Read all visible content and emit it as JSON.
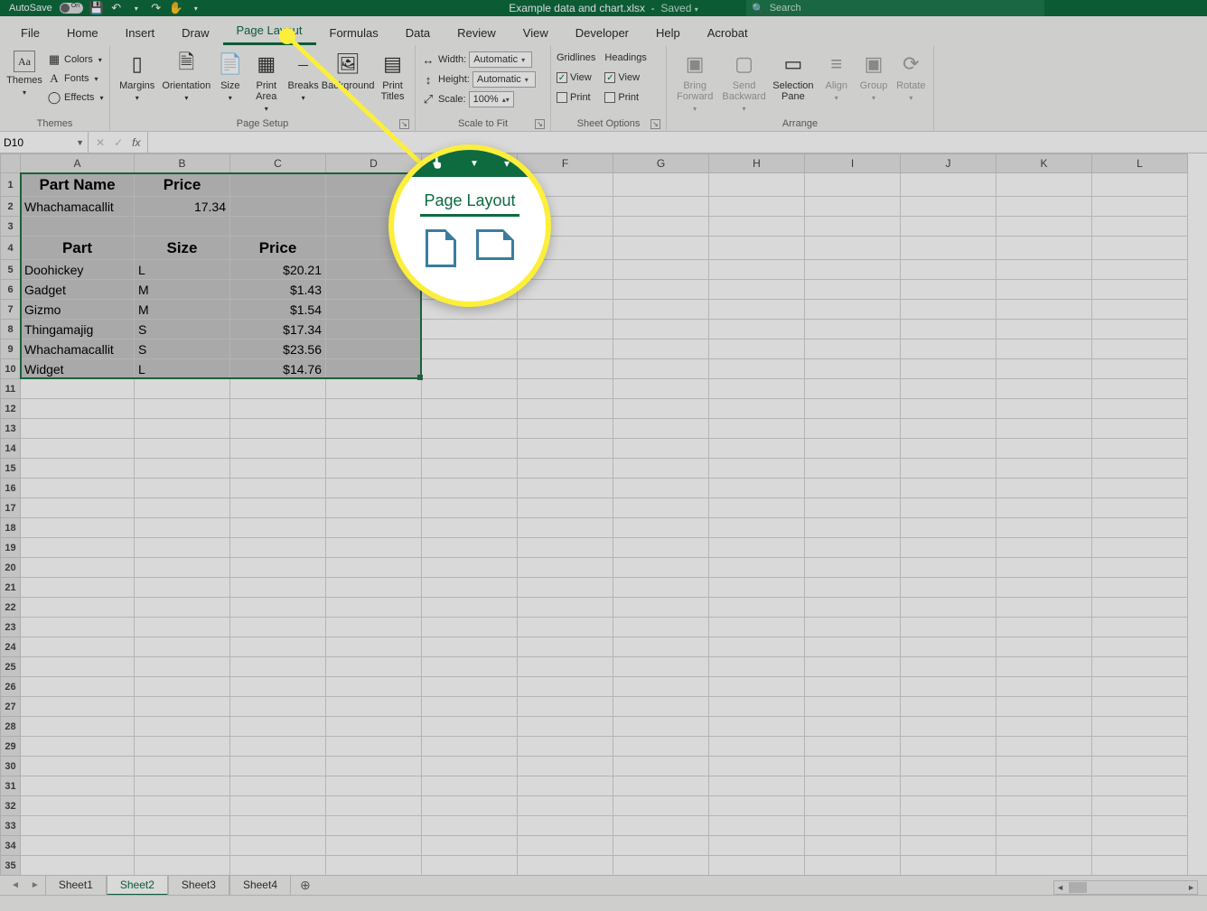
{
  "title": {
    "autosave_label": "AutoSave",
    "autosave_on": "On",
    "filename": "Example data and chart.xlsx",
    "save_status": "Saved",
    "search_placeholder": "Search"
  },
  "tabs": {
    "file": "File",
    "home": "Home",
    "insert": "Insert",
    "draw": "Draw",
    "page_layout": "Page Layout",
    "formulas": "Formulas",
    "data": "Data",
    "review": "Review",
    "view": "View",
    "developer": "Developer",
    "help": "Help",
    "acrobat": "Acrobat",
    "active": "page_layout"
  },
  "ribbon": {
    "themes": {
      "label": "Themes",
      "themes": "Themes",
      "colors": "Colors",
      "fonts": "Fonts",
      "effects": "Effects"
    },
    "page_setup": {
      "label": "Page Setup",
      "margins": "Margins",
      "orientation": "Orientation",
      "size": "Size",
      "print_area": "Print\nArea",
      "breaks": "Breaks",
      "background": "Background",
      "print_titles": "Print\nTitles"
    },
    "scale": {
      "label": "Scale to Fit",
      "width": "Width:",
      "height": "Height:",
      "scale": "Scale:",
      "auto": "Automatic",
      "pct": "100%"
    },
    "sheet_options": {
      "label": "Sheet Options",
      "gridlines": "Gridlines",
      "headings": "Headings",
      "view": "View",
      "print": "Print"
    },
    "arrange": {
      "label": "Arrange",
      "bring_forward": "Bring\nForward",
      "send_backward": "Send\nBackward",
      "selection_pane": "Selection\nPane",
      "align": "Align",
      "group": "Group",
      "rotate": "Rotate"
    }
  },
  "formula_bar": {
    "name_box": "D10"
  },
  "columns": [
    "A",
    "B",
    "C",
    "D",
    "E",
    "F",
    "G",
    "H",
    "I",
    "J",
    "K",
    "L"
  ],
  "row_count": 35,
  "selection": {
    "from": "A1",
    "to": "D10"
  },
  "sheets": {
    "list": [
      "Sheet1",
      "Sheet2",
      "Sheet3",
      "Sheet4"
    ],
    "active": "Sheet2"
  },
  "data_rows": [
    {
      "r": 1,
      "A": "Part Name",
      "B": "Price",
      "hdr": true
    },
    {
      "r": 2,
      "A": "Whachamacallit",
      "B_num": "17.34"
    },
    {
      "r": 4,
      "A": "Part",
      "B": "Size",
      "C": "Price",
      "hdr": true
    },
    {
      "r": 5,
      "A": "Doohickey",
      "B": "L",
      "C": "$20.21"
    },
    {
      "r": 6,
      "A": "Gadget",
      "B": "M",
      "C": "$1.43"
    },
    {
      "r": 7,
      "A": "Gizmo",
      "B": "M",
      "C": "$1.54"
    },
    {
      "r": 8,
      "A": "Thingamajig",
      "B": "S",
      "C": "$17.34"
    },
    {
      "r": 9,
      "A": "Whachamacallit",
      "B": "S",
      "C": "$23.56"
    },
    {
      "r": 10,
      "A": "Widget",
      "B": "L",
      "C": "$14.76"
    }
  ],
  "callout": {
    "label": "Page Layout"
  }
}
